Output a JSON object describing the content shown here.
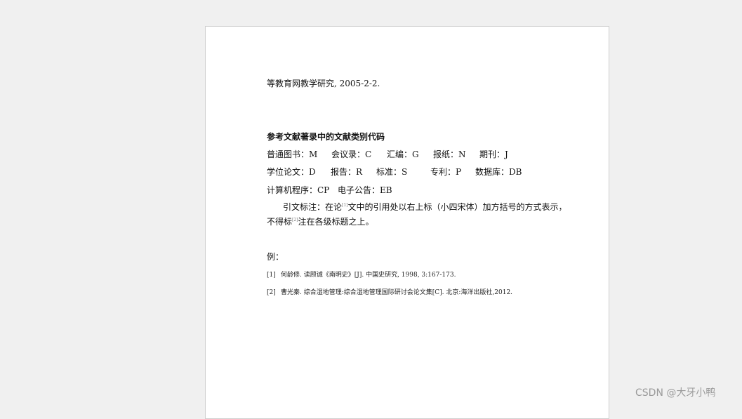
{
  "document": {
    "top_line": "等教育网教学研究, 2005-2-2.",
    "section_heading": "参考文献著录中的文献类别代码",
    "codes_row1": [
      {
        "label": "普通图书：M"
      },
      {
        "label": "会议录：C"
      },
      {
        "label": "汇编：G"
      },
      {
        "label": "报纸：N"
      },
      {
        "label": "期刊：J"
      }
    ],
    "codes_row2": [
      {
        "label": "学位论文：D"
      },
      {
        "label": "报告：R"
      },
      {
        "label": "标准：S"
      },
      {
        "label": "专利：P"
      },
      {
        "label": "数据库：DB"
      }
    ],
    "codes_row3": [
      {
        "label": "计算机程序：CP"
      },
      {
        "label": "电子公告：EB"
      }
    ],
    "note": {
      "part1": "引文标注：在论",
      "sup1": "[1]",
      "part2": "文中的引用处以右上标（小四宋体）加方括号的方式表示，",
      "part3": "不得标",
      "sup2": "[2]",
      "part4": "注在各级标题之上。"
    },
    "example_label": "例：",
    "references": [
      {
        "num": "[1]",
        "text": "何龄修. 读顾诚《南明史》[J]. 中国史研究,   1998,   3:167-173."
      },
      {
        "num": "[2]",
        "text": "曹光秦. 综合湿地管理:综合湿地管理国际研讨会论文集[C]. 北京:海洋出版社,2012."
      }
    ]
  },
  "watermark": "CSDN @大牙小鸭"
}
